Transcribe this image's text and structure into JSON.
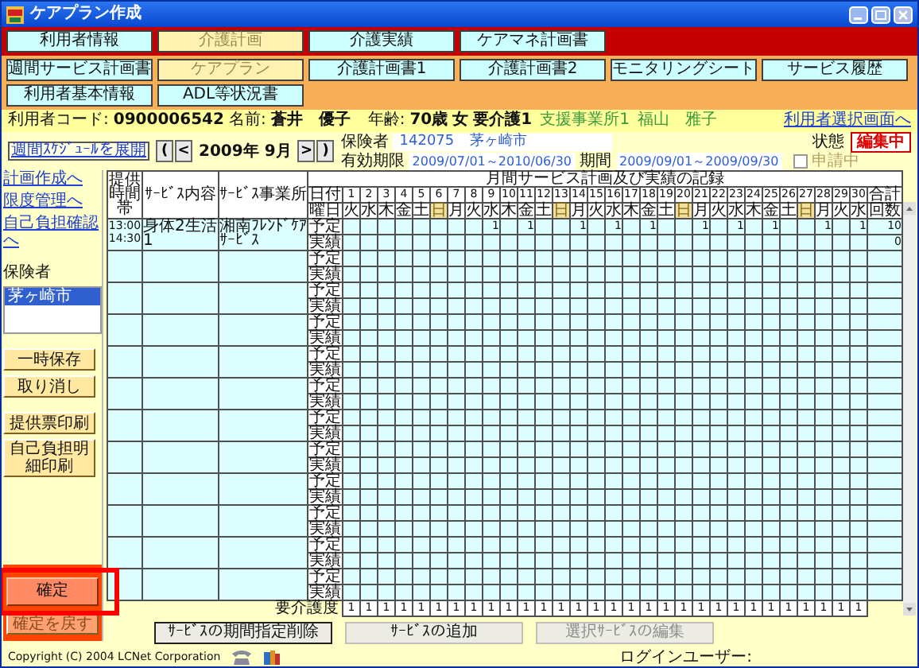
{
  "window": {
    "title": "ケアプラン作成"
  },
  "main_tabs": [
    {
      "label": "利用者情報",
      "selected": false
    },
    {
      "label": "介護計画",
      "selected": true
    },
    {
      "label": "介護実績",
      "selected": false
    },
    {
      "label": "ケアマネ計画書",
      "selected": false
    }
  ],
  "sub_tabs": [
    {
      "label": "週間サービス計画書",
      "selected": false
    },
    {
      "label": "ケアプラン",
      "selected": true
    },
    {
      "label": "介護計画書1",
      "selected": false
    },
    {
      "label": "介護計画書2",
      "selected": false
    },
    {
      "label": "モニタリングシート",
      "selected": false
    },
    {
      "label": "サービス履歴",
      "selected": false
    },
    {
      "label": "利用者基本情報",
      "selected": false
    },
    {
      "label": "ADL等状況書",
      "selected": false
    }
  ],
  "user": {
    "code_label": "利用者コード:",
    "code": "0900006542",
    "name_label": "名前:",
    "name": "蒼井　優子",
    "age_label": "年齢:",
    "age": "70歳",
    "sex": "女",
    "care_level": "要介護1",
    "office": "支援事業所1",
    "manager": "福山　雅子",
    "link": "利用者選択画面へ"
  },
  "nav": {
    "schedule_link": "週間ｽｹｼﾞｭｰﾙを展開",
    "first": "(",
    "prev": "<",
    "month": "2009年 9月",
    "next": ">",
    "last": ")"
  },
  "insurer": {
    "label": "保険者",
    "number": "142075",
    "name": "茅ヶ崎市"
  },
  "validity": {
    "label": "有効期限",
    "value": "2009/07/01～2010/06/30"
  },
  "period": {
    "label": "期間",
    "value": "2009/09/01～2009/09/30"
  },
  "applying": {
    "label": "申請中",
    "checked": false
  },
  "status": {
    "label": "状態",
    "value": "編集中"
  },
  "sidebar": {
    "links": [
      "計画作成へ",
      "限度管理へ",
      "自己負担確認へ"
    ],
    "insurer_label": "保険者",
    "insurer_list": [
      {
        "label": "茅ヶ崎市",
        "selected": true
      }
    ],
    "buttons": [
      {
        "label": "一時保存",
        "disabled": false
      },
      {
        "label": "取り消し",
        "disabled": false
      }
    ],
    "print_buttons": [
      {
        "label": "提供票印刷",
        "disabled": false
      },
      {
        "label": "自己負担明細印刷",
        "disabled": false
      }
    ],
    "confirm": {
      "label": "確定",
      "disabled": false
    },
    "unconfirm": {
      "label": "確定を戻す",
      "disabled": true
    }
  },
  "table": {
    "title": "月間サービス計画及び実績の記録",
    "columns": [
      "提供時間帯",
      "ｻｰﾋﾞｽ内容",
      "ｻｰﾋﾞｽ事業所"
    ],
    "date_label": "日付",
    "weekday_label": "曜日",
    "total_label": "合計",
    "count_label": "回数",
    "days": [
      {
        "date": "1",
        "weekday": "火",
        "sunday": false
      },
      {
        "date": "2",
        "weekday": "水",
        "sunday": false
      },
      {
        "date": "3",
        "weekday": "木",
        "sunday": false
      },
      {
        "date": "4",
        "weekday": "金",
        "sunday": false
      },
      {
        "date": "5",
        "weekday": "土",
        "sunday": false
      },
      {
        "date": "6",
        "weekday": "日",
        "sunday": true
      },
      {
        "date": "7",
        "weekday": "月",
        "sunday": false
      },
      {
        "date": "8",
        "weekday": "火",
        "sunday": false
      },
      {
        "date": "9",
        "weekday": "水",
        "sunday": false
      },
      {
        "date": "10",
        "weekday": "木",
        "sunday": false
      },
      {
        "date": "11",
        "weekday": "金",
        "sunday": false
      },
      {
        "date": "12",
        "weekday": "土",
        "sunday": false
      },
      {
        "date": "13",
        "weekday": "日",
        "sunday": true
      },
      {
        "date": "14",
        "weekday": "月",
        "sunday": false
      },
      {
        "date": "15",
        "weekday": "火",
        "sunday": false
      },
      {
        "date": "16",
        "weekday": "水",
        "sunday": false
      },
      {
        "date": "17",
        "weekday": "木",
        "sunday": false
      },
      {
        "date": "18",
        "weekday": "金",
        "sunday": false
      },
      {
        "date": "19",
        "weekday": "土",
        "sunday": false
      },
      {
        "date": "20",
        "weekday": "日",
        "sunday": true
      },
      {
        "date": "21",
        "weekday": "月",
        "sunday": false
      },
      {
        "date": "22",
        "weekday": "火",
        "sunday": false
      },
      {
        "date": "23",
        "weekday": "水",
        "sunday": false
      },
      {
        "date": "24",
        "weekday": "木",
        "sunday": false
      },
      {
        "date": "25",
        "weekday": "金",
        "sunday": false
      },
      {
        "date": "26",
        "weekday": "土",
        "sunday": false
      },
      {
        "date": "27",
        "weekday": "日",
        "sunday": true
      },
      {
        "date": "28",
        "weekday": "月",
        "sunday": false
      },
      {
        "date": "29",
        "weekday": "火",
        "sunday": false
      },
      {
        "date": "30",
        "weekday": "水",
        "sunday": false
      }
    ],
    "services": [
      {
        "start": "13:00",
        "end": "14:30",
        "content": "身体2生活1",
        "office": "湘南ﾌﾚﾝﾄﾞｹｱｻｰﾋﾞｽ",
        "plan_label": "予定",
        "actual_label": "実績",
        "plan": {
          "9": "1",
          "11": "1",
          "14": "1",
          "16": "1",
          "18": "1",
          "21": "1",
          "23": "1",
          "25": "1",
          "28": "1",
          "30": "1"
        },
        "plan_total": "10",
        "actual_total": "0"
      },
      {
        "plan_label": "予定",
        "actual_label": "実績"
      },
      {
        "plan_label": "予定",
        "actual_label": "実績"
      },
      {
        "plan_label": "予定",
        "actual_label": "実績"
      },
      {
        "plan_label": "予定",
        "actual_label": "実績"
      },
      {
        "plan_label": "予定",
        "actual_label": "実績"
      },
      {
        "plan_label": "予定",
        "actual_label": "実績"
      },
      {
        "plan_label": "予定",
        "actual_label": "実績"
      },
      {
        "plan_label": "予定",
        "actual_label": "実績"
      },
      {
        "plan_label": "予定",
        "actual_label": "実績"
      },
      {
        "plan_label": "予定",
        "actual_label": "実績"
      },
      {
        "plan_label": "予定",
        "actual_label": "実績"
      }
    ],
    "care_level_label": "要介護度",
    "care_levels": [
      "1",
      "1",
      "1",
      "1",
      "1",
      "1",
      "1",
      "1",
      "1",
      "1",
      "1",
      "1",
      "1",
      "1",
      "1",
      "1",
      "1",
      "1",
      "1",
      "1",
      "1",
      "1",
      "1",
      "1",
      "1",
      "1",
      "1",
      "1",
      "1",
      "1"
    ]
  },
  "bottom_buttons": [
    {
      "label": "ｻｰﾋﾞｽの期間指定削除",
      "focused": true,
      "disabled": false
    },
    {
      "label": "ｻｰﾋﾞｽの追加",
      "focused": false,
      "disabled": false
    },
    {
      "label": "選択ｻｰﾋﾞｽの編集",
      "focused": false,
      "disabled": true
    }
  ],
  "footer": {
    "copyright": "Copyright (C) 2004 LCNet Corporation",
    "login_label": "ログインユーザー:"
  }
}
